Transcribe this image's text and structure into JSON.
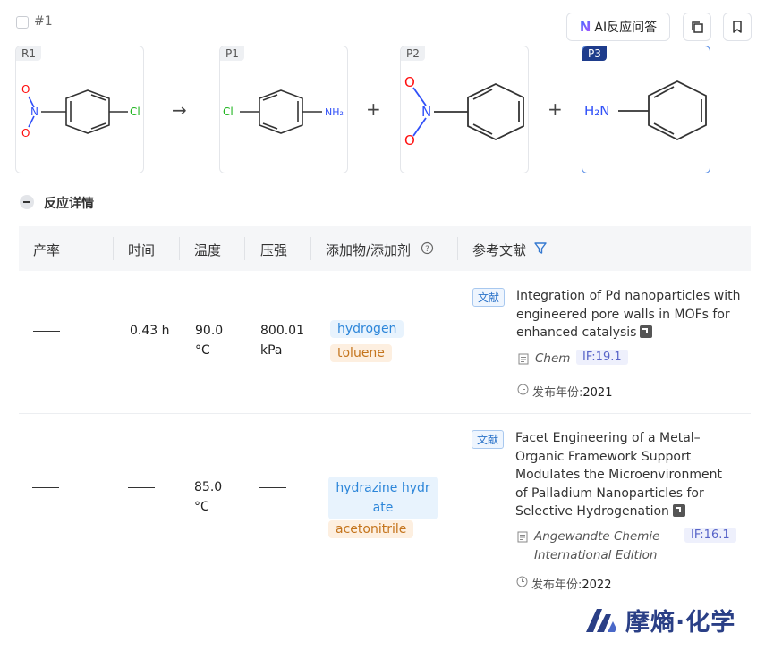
{
  "reaction": {
    "id": "#1"
  },
  "toolbar": {
    "ai_label": "AI反应问答",
    "ai_logo": "AI"
  },
  "molecules": [
    {
      "tag": "R1",
      "labels": {
        "o1": "O",
        "n": "N",
        "o2": "O",
        "cl": "Cl"
      }
    },
    {
      "tag": "P1",
      "labels": {
        "cl": "Cl",
        "nh2": "NH₂"
      }
    },
    {
      "tag": "P2",
      "labels": {
        "o1": "O",
        "n": "N",
        "o2": "O"
      }
    },
    {
      "tag": "P3",
      "labels": {
        "nh2": "H₂N"
      }
    }
  ],
  "operators": {
    "arrow": "→",
    "plus1": "+",
    "plus2": "+"
  },
  "section": {
    "title": "反应详情"
  },
  "table": {
    "headers": {
      "yield": "产率",
      "time": "时间",
      "temp": "温度",
      "pressure": "压强",
      "additive": "添加物/添加剂",
      "refs": "参考文献"
    },
    "rows": [
      {
        "time": "0.43 h",
        "temp_value": "90.0",
        "temp_unit": "°C",
        "pressure_value": "800.01",
        "pressure_unit": "kPa",
        "additives": [
          "hydrogen",
          "toluene"
        ],
        "ref": {
          "badge": "文献",
          "title_lines": [
            "Integration of Pd nanoparticles with",
            "engineered pore walls in MOFs for",
            "enhanced catalysis"
          ],
          "journal_lines": [
            "Chem"
          ],
          "if": "IF:19.1",
          "year_label": "发布年份:",
          "year": "2021"
        }
      },
      {
        "temp_value": "85.0",
        "temp_unit": "°C",
        "additives": [
          "hydrazine hydr",
          "ate",
          "acetonitrile"
        ],
        "ref": {
          "badge": "文献",
          "title_lines": [
            "Facet Engineering of a Metal–",
            "Organic Framework Support",
            "Modulates the Microenvironment",
            "of Palladium Nanoparticles for",
            "Selective Hydrogenation"
          ],
          "journal_lines": [
            "Angewandte Chemie",
            "International Edition"
          ],
          "if": "IF:16.1",
          "year_label": "发布年份:",
          "year": "2022"
        }
      }
    ]
  },
  "brand": {
    "text": "摩熵·化学"
  },
  "colors": {
    "accent": "#1e3c8c",
    "selected_border": "#5a8ee6",
    "nitrogen": "#3050f8",
    "oxygen": "#ff0d0d",
    "chlorine": "#1fb51f"
  }
}
